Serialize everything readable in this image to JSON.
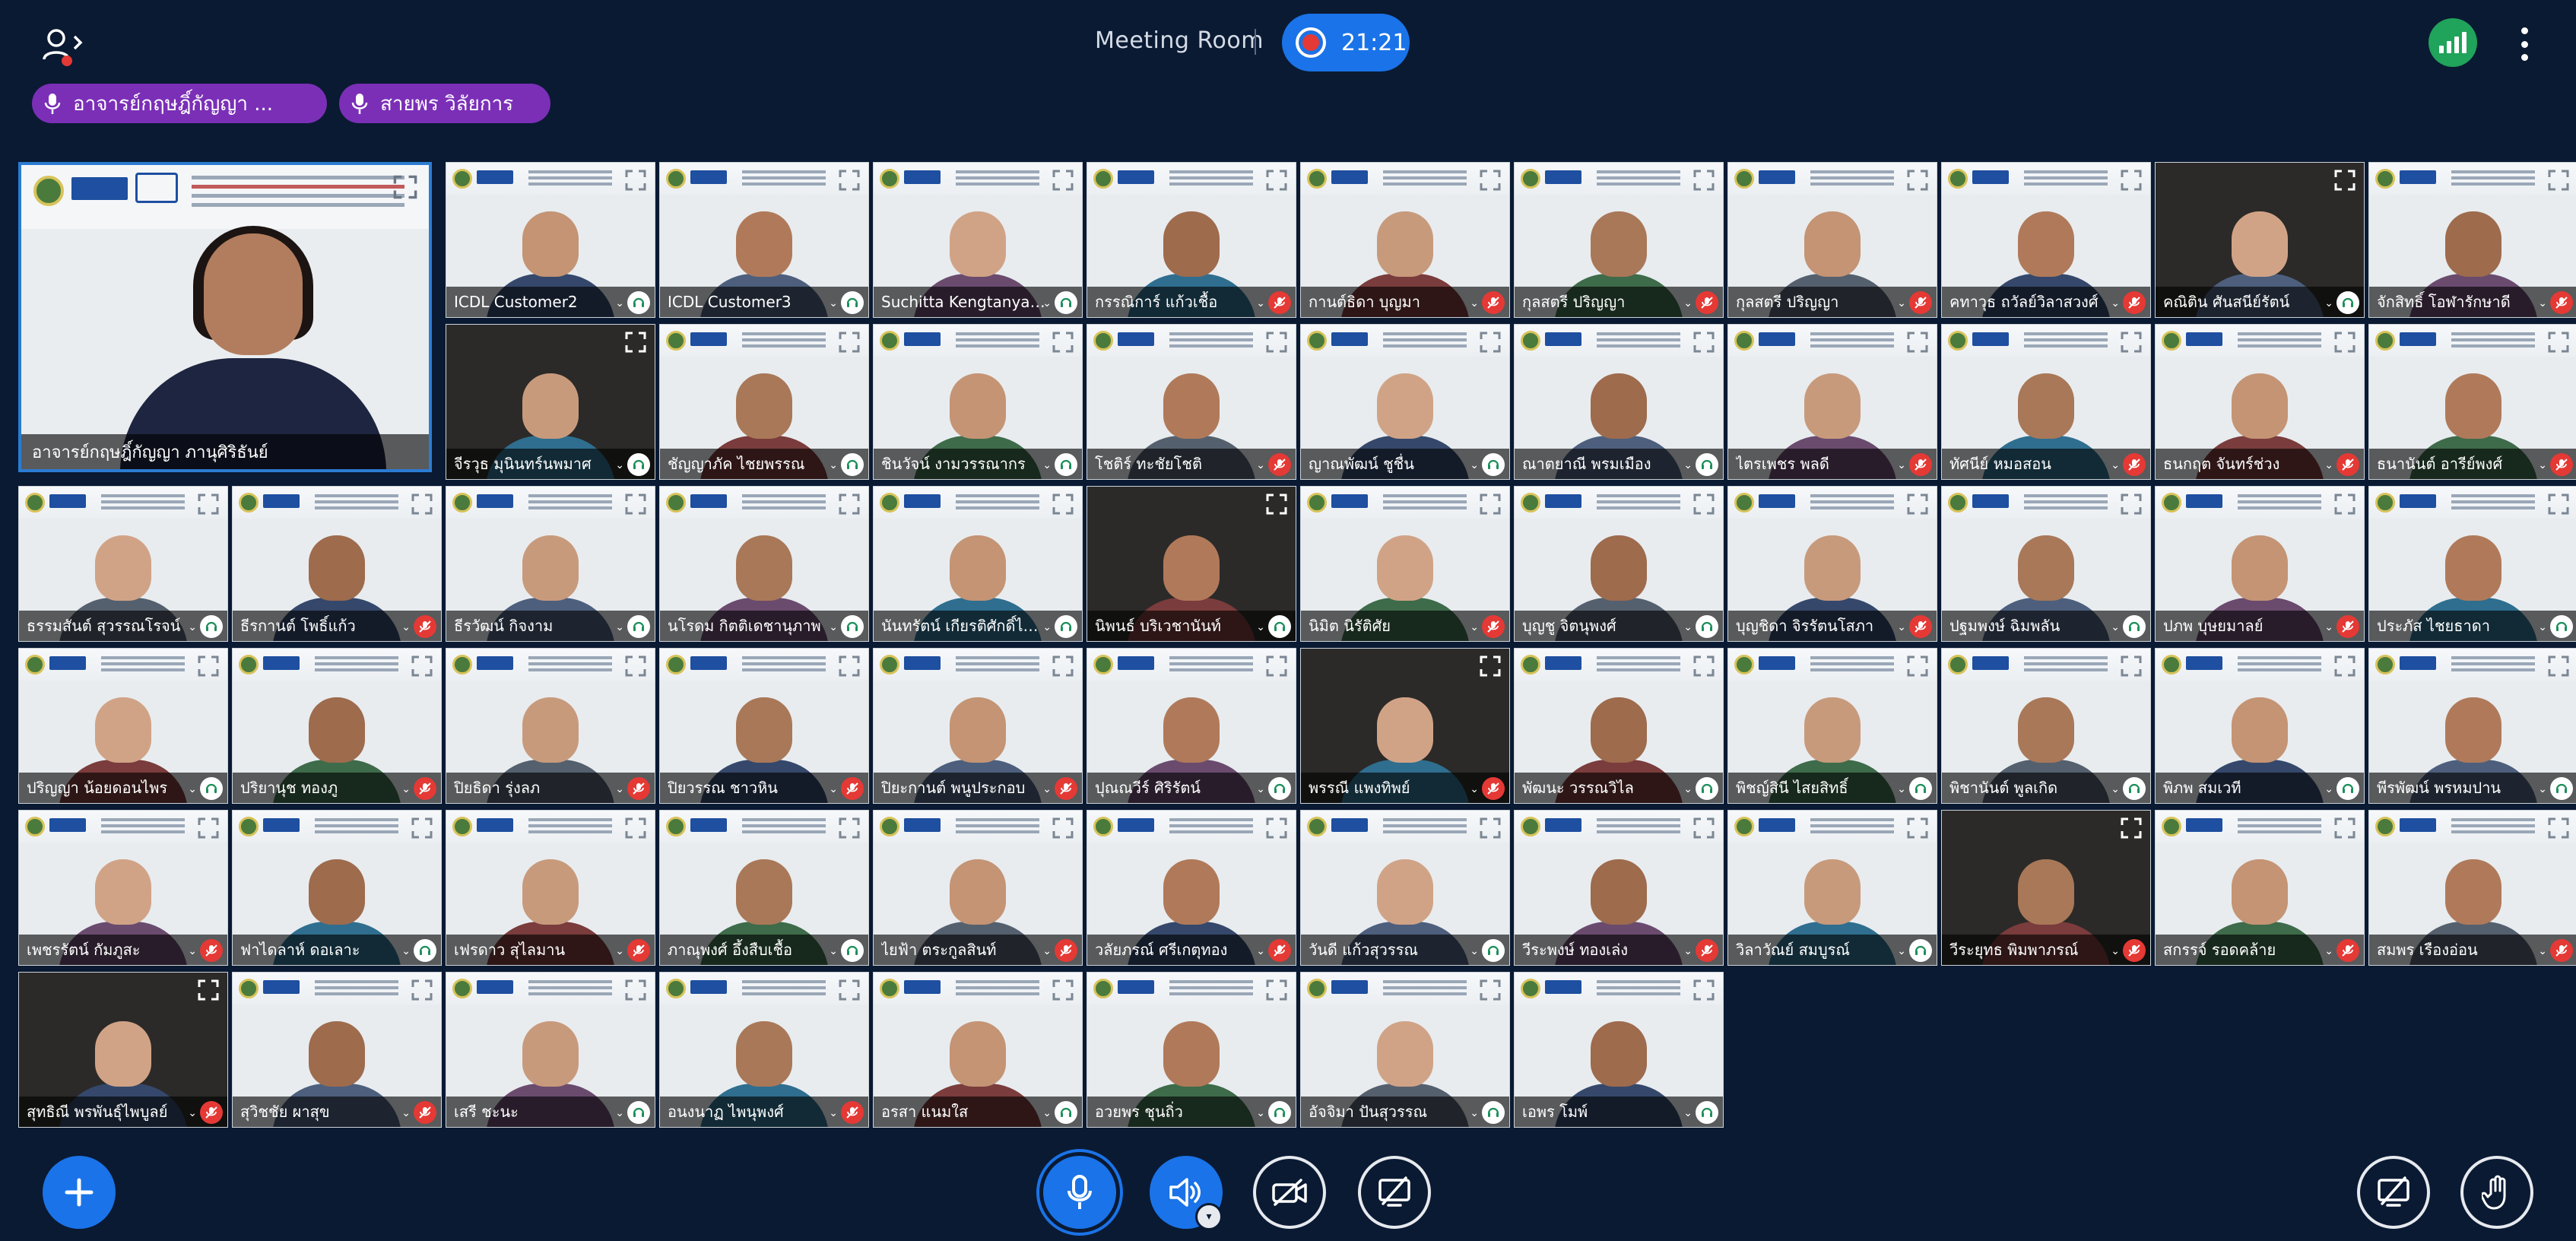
{
  "header": {
    "meeting_title": "Meeting Room",
    "timer": "21:21",
    "talking": [
      "อาจารย์กฤษฎิ์กัญญา ...",
      "สายพร วิลัยการ"
    ]
  },
  "colors": {
    "background": "#0a1a33",
    "accent": "#1a73e8",
    "talking_pill": "#7b2fb7",
    "muted": "#e53935",
    "signal": "#20a35a"
  },
  "featured": {
    "name": "อาจารย์กฤษฎิ์กัญญา ภานุศิริธันย์"
  },
  "tiles": [
    {
      "name": "ICDL Customer2",
      "muted": false
    },
    {
      "name": "ICDL Customer3",
      "muted": false
    },
    {
      "name": "Suchitta Kengtanyagam",
      "muted": false
    },
    {
      "name": "กรรณิการ์ แก้วเชื้อ",
      "muted": true
    },
    {
      "name": "กานต์ธิดา บุญมา",
      "muted": true
    },
    {
      "name": "กุลสตรี ปริญญา",
      "muted": true
    },
    {
      "name": "กุลสตรี ปริญญา",
      "muted": true
    },
    {
      "name": "คทาวุธ ถวัลย์วิลาสวงศ์",
      "muted": true
    },
    {
      "name": "คณิติน ศันสนีย์รัตน์",
      "muted": false
    },
    {
      "name": "จักสิทธิ์ โอฬารักษาดี",
      "muted": true
    },
    {
      "name": "จีรวุธ มุนินทร์นพมาศ",
      "muted": false
    },
    {
      "name": "ชัญญาภัค ไชยพรรณ",
      "muted": false
    },
    {
      "name": "ชินวัจน์ งามวรรณากร",
      "muted": false
    },
    {
      "name": "โชติร์ ทะชัยโชติ",
      "muted": true
    },
    {
      "name": "ญาณพัฒน์ ชูชื่น",
      "muted": false
    },
    {
      "name": "ณาตยาณี พรมเมือง",
      "muted": false
    },
    {
      "name": "ไตรเพชร พลดี",
      "muted": true
    },
    {
      "name": "ทัศนีย์ หมอสอน",
      "muted": true
    },
    {
      "name": "ธนกฤต จันทร์ช่วง",
      "muted": true
    },
    {
      "name": "ธนานันต์ อารีย์พงศ์",
      "muted": true
    },
    {
      "name": "ธรรมสันต์ สุวรรณโรจน์",
      "muted": false
    },
    {
      "name": "ธีรกานต์ โพธิ์แก้ว",
      "muted": true
    },
    {
      "name": "ธีรวัฒน์ กิจงาม",
      "muted": false
    },
    {
      "name": "นโรดม กิตติเดชานุภาพ",
      "muted": false
    },
    {
      "name": "นันทรัตน์ เกียรติศักดิ์ไสยเวช",
      "muted": false
    },
    {
      "name": "นิพนธ์ บริเวชานันท์",
      "muted": false
    },
    {
      "name": "นิมิต นิรัติศัย",
      "muted": true
    },
    {
      "name": "บุญชู จิตนุพงศ์",
      "muted": false
    },
    {
      "name": "บุญชิดา จิรรัตนโสภา",
      "muted": true
    },
    {
      "name": "ปฐมพงษ์ ฉิมพลัน",
      "muted": false
    },
    {
      "name": "ปภพ บุษยมาลย์",
      "muted": true
    },
    {
      "name": "ประภัส ไชยธาดา",
      "muted": false
    },
    {
      "name": "ปริญญา น้อยดอนไพร",
      "muted": false
    },
    {
      "name": "ปริยานุช ทองภู",
      "muted": true
    },
    {
      "name": "ปิยธิดา รุ่งลภ",
      "muted": true
    },
    {
      "name": "ปิยวรรณ ชาวหิน",
      "muted": true
    },
    {
      "name": "ปิยะกานต์ พนูประกอบ",
      "muted": true
    },
    {
      "name": "ปุณณวีร์ ศิริรัตน์",
      "muted": false
    },
    {
      "name": "พรรณี แพงทิพย์",
      "muted": true
    },
    {
      "name": "พัฒนะ วรรณวิไล",
      "muted": false
    },
    {
      "name": "พิชญ์สินี ไสยสิทธิ์",
      "muted": false
    },
    {
      "name": "พิชานันต์ พูลเกิด",
      "muted": false
    },
    {
      "name": "พิภพ สมเวที",
      "muted": false
    },
    {
      "name": "พีรพัฒน์ พรหมปาน",
      "muted": false
    },
    {
      "name": "เพชรรัตน์ กัมภูสะ",
      "muted": true
    },
    {
      "name": "ฟาไดลาห์ ดอเลาะ",
      "muted": false
    },
    {
      "name": "เฟรดาว สุไลมาน",
      "muted": true
    },
    {
      "name": "ภาณุพงศ์ อึ้งสืบเชื้อ",
      "muted": false
    },
    {
      "name": "ไยฟ้า ตระกูลสินท์",
      "muted": true
    },
    {
      "name": "วลัยภรณ์ ศรีเกตุทอง",
      "muted": true
    },
    {
      "name": "วันดี แก้วสุวรรณ",
      "muted": false
    },
    {
      "name": "วีระพงษ์ ทองเล่ง",
      "muted": true
    },
    {
      "name": "วิลาวัณย์ สมบูรณ์",
      "muted": false
    },
    {
      "name": "วีระยุทธ พิมพาภรณ์",
      "muted": true
    },
    {
      "name": "สกรรจ์ รอดคล้าย",
      "muted": true
    },
    {
      "name": "สมพร เรืองอ่อน",
      "muted": true
    },
    {
      "name": "สุทธิณี พรพันธุ์ไพบูลย์",
      "muted": true
    },
    {
      "name": "สุวิชชัย ผาสุข",
      "muted": true
    },
    {
      "name": "เสรี ชะนะ",
      "muted": false
    },
    {
      "name": "อนงนาฏ ไพนุพงศ์",
      "muted": true
    },
    {
      "name": "อรสา แนมใส",
      "muted": false
    },
    {
      "name": "อวยพร ชุนถิ่ว",
      "muted": false
    },
    {
      "name": "อัจจิมา ปันสุวรรณ",
      "muted": false
    },
    {
      "name": "เอพร โมพ์",
      "muted": false
    }
  ]
}
